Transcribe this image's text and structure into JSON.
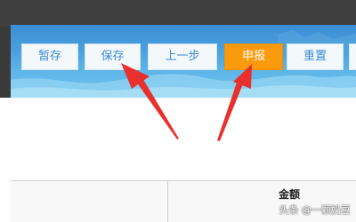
{
  "toolbar": {
    "buttons": [
      {
        "label": "暂存"
      },
      {
        "label": "保存"
      },
      {
        "label": "上一步"
      },
      {
        "label": "申报",
        "primary": true
      },
      {
        "label": "重置"
      }
    ]
  },
  "table": {
    "column_header": "金额"
  },
  "watermark": {
    "text": "头条 @一颗奶豆"
  },
  "colors": {
    "button_text": "#3d8ad3",
    "primary_button_bg": "#fa9a0c",
    "banner_blue": "#4aa0de",
    "arrow_red": "#e8312d"
  }
}
